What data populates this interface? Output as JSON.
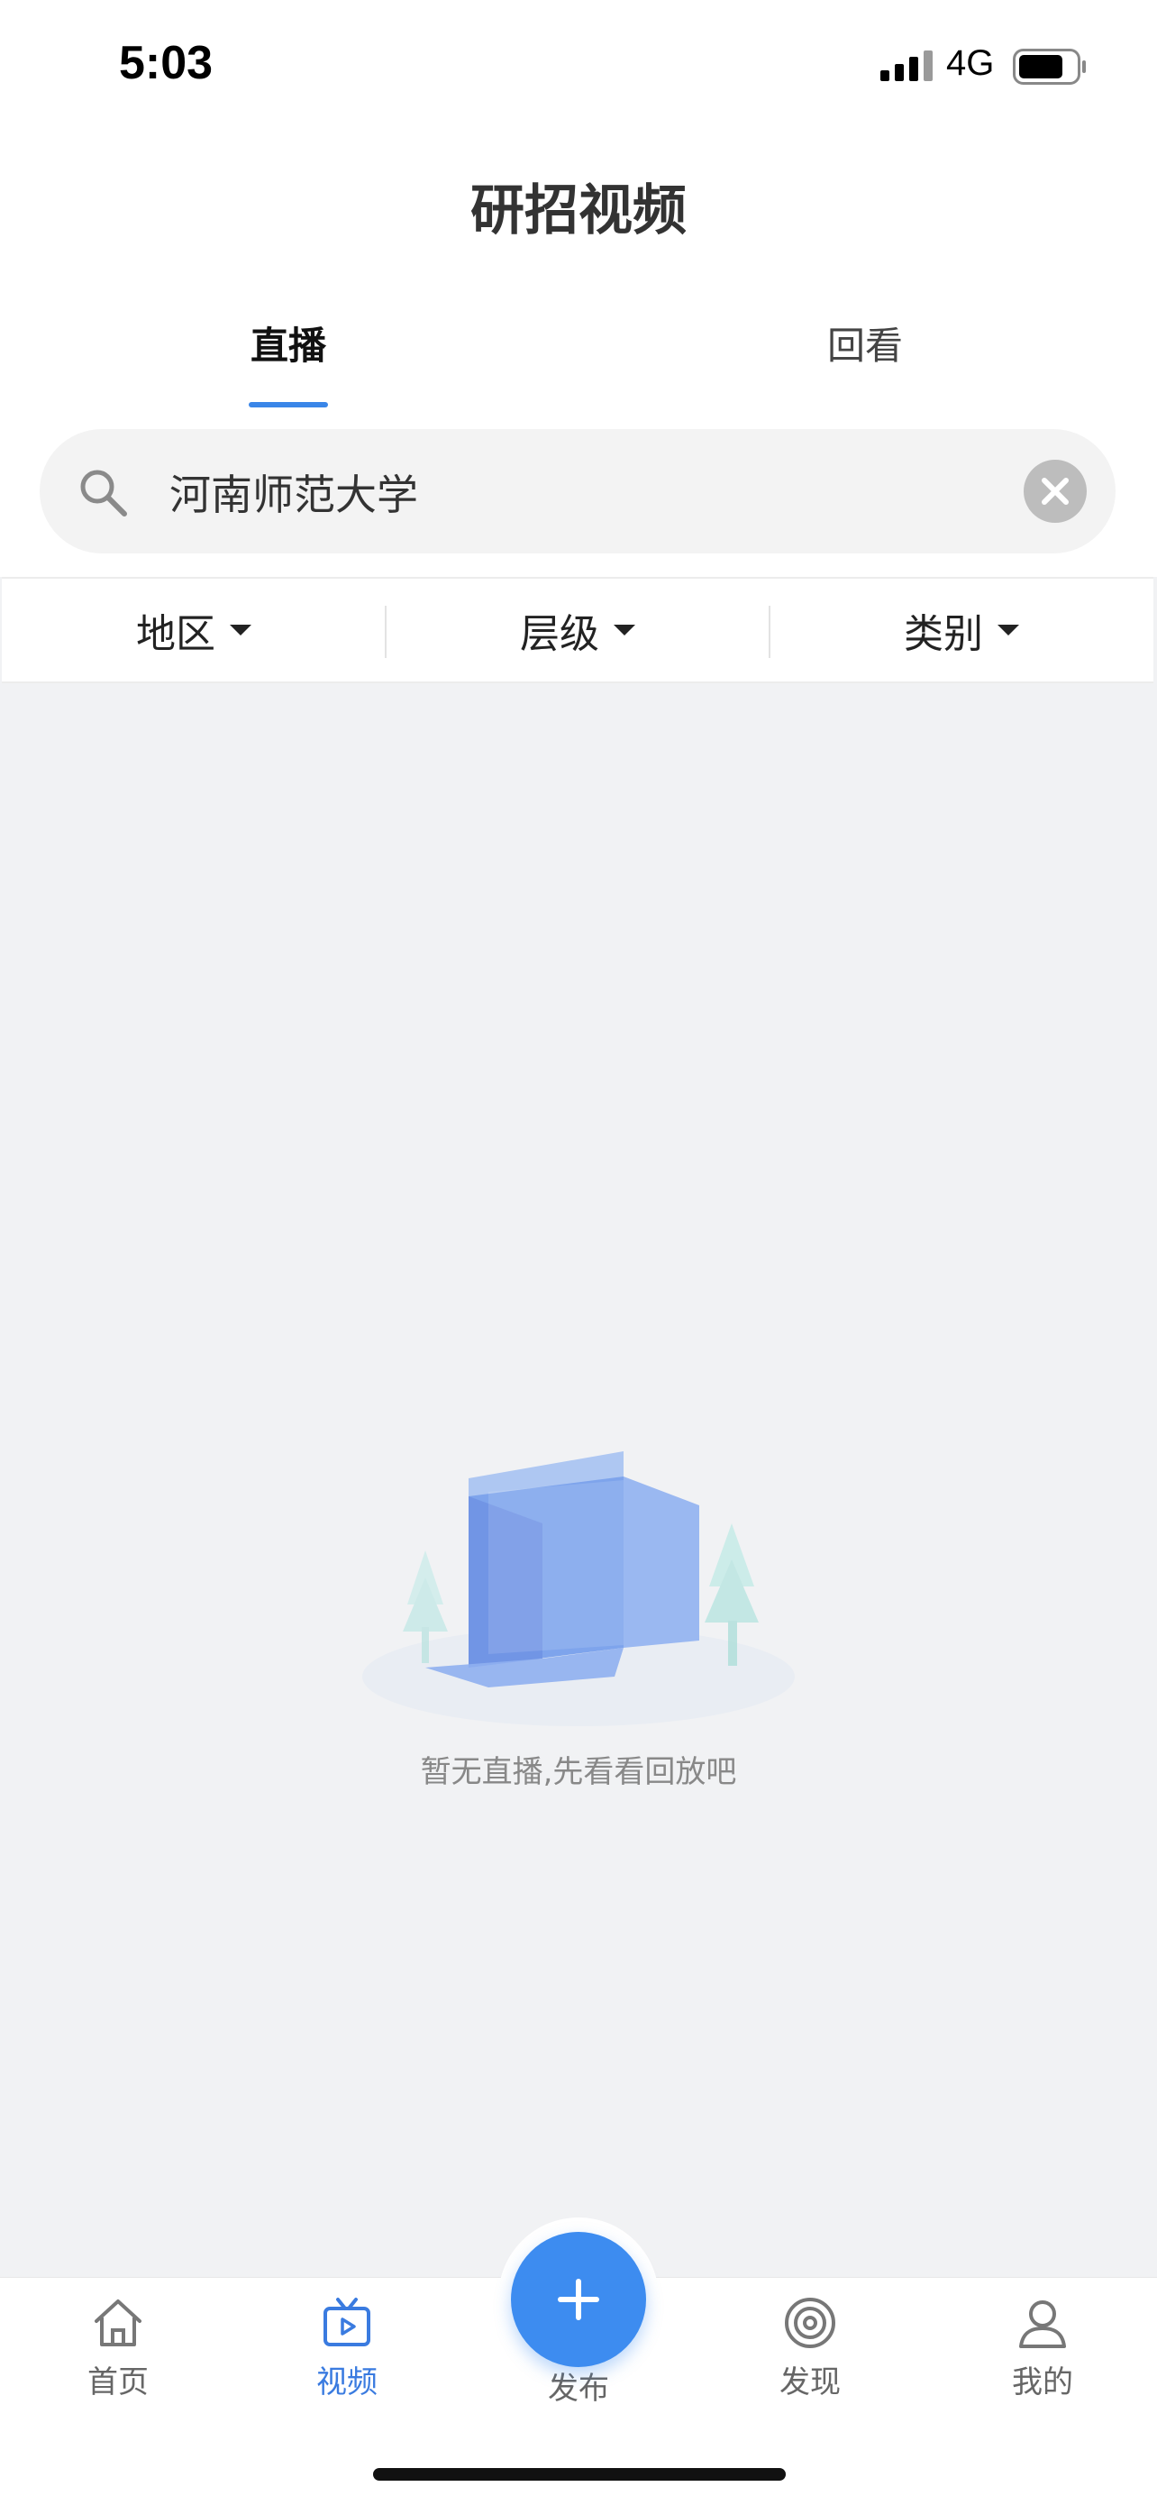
{
  "status_bar": {
    "time": "5:03",
    "network": "4G"
  },
  "header": {
    "title": "研招视频"
  },
  "tabs": [
    {
      "label": "直播",
      "active": true
    },
    {
      "label": "回看",
      "active": false
    }
  ],
  "search": {
    "value": "河南师范大学",
    "icon": "search-icon"
  },
  "filters": [
    {
      "label": "地区"
    },
    {
      "label": "层级"
    },
    {
      "label": "类别"
    }
  ],
  "empty_state": {
    "message": "暂无直播,先看看回放吧"
  },
  "tabbar": {
    "items": [
      {
        "label": "首页",
        "icon": "home-icon",
        "active": false
      },
      {
        "label": "视频",
        "icon": "tv-icon",
        "active": true
      },
      {
        "label": "发布",
        "icon": "plus-icon",
        "active": false
      },
      {
        "label": "发现",
        "icon": "target-icon",
        "active": false
      },
      {
        "label": "我的",
        "icon": "user-icon",
        "active": false
      }
    ]
  },
  "colors": {
    "accent": "#3a86e8",
    "background": "#f1f2f4"
  }
}
